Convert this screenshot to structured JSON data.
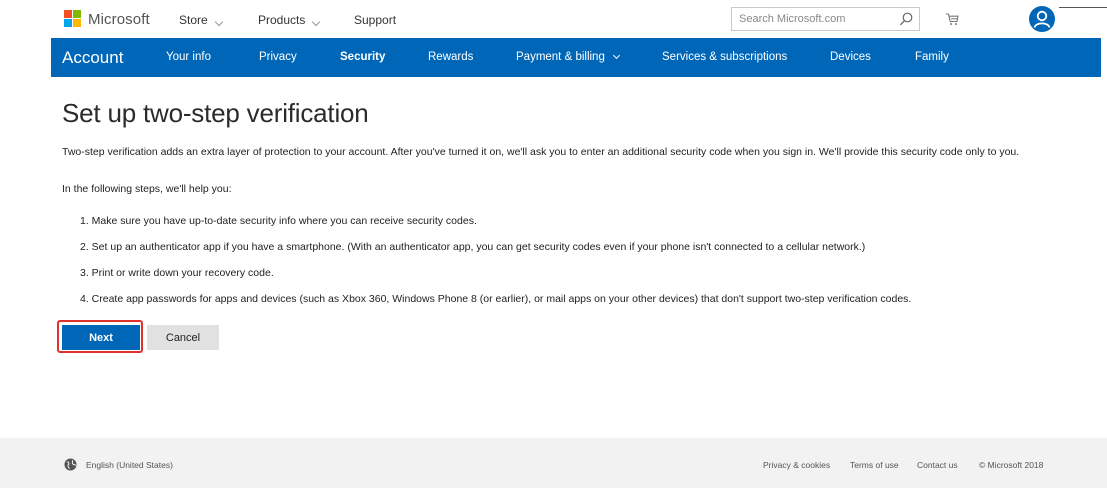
{
  "colors": {
    "brand_blue": "#0067b8",
    "highlight_red": "#e0322d",
    "footer_bg": "#f2f2f2",
    "logo": [
      "#f25022",
      "#7fba00",
      "#00a4ef",
      "#ffb900"
    ]
  },
  "header": {
    "logo_text": "Microsoft",
    "nav": [
      {
        "label": "Store",
        "has_caret": true
      },
      {
        "label": "Products",
        "has_caret": true
      },
      {
        "label": "Support",
        "has_caret": false
      }
    ],
    "search_placeholder": "Search Microsoft.com",
    "icons": [
      "search-icon",
      "cart-icon",
      "account-icon"
    ]
  },
  "account_bar": {
    "title": "Account",
    "items": [
      {
        "label": "Your info"
      },
      {
        "label": "Privacy"
      },
      {
        "label": "Security",
        "active": true
      },
      {
        "label": "Rewards"
      },
      {
        "label": "Payment & billing",
        "has_caret": true
      },
      {
        "label": "Services & subscriptions"
      },
      {
        "label": "Devices"
      },
      {
        "label": "Family"
      }
    ]
  },
  "main": {
    "title": "Set up two-step verification",
    "intro": "Two-step verification adds an extra layer of protection to your account. After you've turned it on, we'll ask you to enter an additional security code when you sign in. We'll provide this security code only to you.",
    "help_text": "In the following steps, we'll help you:",
    "steps": [
      "1. Make sure you have up-to-date security info where you can receive security codes.",
      "2. Set up an authenticator app if you have a smartphone. (With an authenticator app, you can get security codes even if your phone isn't connected to a cellular network.)",
      "3. Print or write down your recovery code.",
      "4. Create app passwords for apps and devices (such as Xbox 360, Windows Phone 8 (or earlier), or mail apps on your other devices) that don't support two-step verification codes."
    ],
    "next_label": "Next",
    "cancel_label": "Cancel"
  },
  "footer": {
    "language": "English (United States)",
    "links": [
      "Privacy & cookies",
      "Terms of use",
      "Contact us",
      "© Microsoft 2018"
    ]
  }
}
